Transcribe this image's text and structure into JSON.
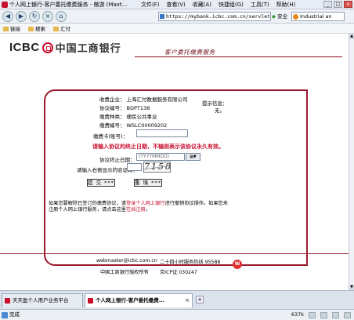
{
  "window": {
    "title": "个人网上银行-客户委托缴费服务 - 傲游 (Maxt...",
    "menu": [
      "文件(F)",
      "查看(V)",
      "收藏(A)",
      "快捷组(G)",
      "工具(T)",
      "帮助(H)"
    ],
    "buttons": [
      "_",
      "□",
      "×"
    ]
  },
  "toolbar": {
    "back": "◀",
    "forward": "▶",
    "refresh": "↻",
    "stop": "×",
    "home": "⌂",
    "address": "https://mybank.icbc.com.cn/servlet/ICBC",
    "security": "安全",
    "search_engine": "Industrial an"
  },
  "favbar": {
    "items": [
      "链接",
      "搜索",
      "汇付"
    ]
  },
  "page": {
    "logo_text": "ICBC",
    "logo_cn": "中国工商银行",
    "slogan": "客户委托缴费服务",
    "form": {
      "company_label": "收费企业：",
      "company_value": "上海汇付数据服务有限公司",
      "protocol_label": "协议编号：",
      "protocol_value": "BDPT138",
      "type_label": "缴费种类：",
      "type_value": "便民公共事业",
      "code_label": "缴费编号：",
      "code_value": "WSLC00009202",
      "card_label": "缴费卡(账号)：",
      "card_value": "",
      "warning": "请输入协议的终止日期，不输则表示该协议永久有效。",
      "end_date_label": "协议终止日期：",
      "end_date_placeholder": "(YYYYMMDD)",
      "captcha_label": "请输入右侧显示的验证码：",
      "captcha_value": "",
      "captcha_text": "7158",
      "submit": "提 交 ***",
      "reset": "重 填 ***",
      "prompt_label": "提示信息：",
      "prompt_value": "无。"
    },
    "note_part1": "如果您要解除已签订的缴费协议，请",
    "note_link1": "登录个人网上银行",
    "note_part2": "进行撤销协议操作。如果您未注册个人网上银行服务，请点击这里",
    "note_link2": "在线注册",
    "note_part3": "。",
    "footer": {
      "email": "webmaster@icbc.com.cn",
      "hotline": "二十四小时服务热线 95588",
      "copyright": "中国工商银行版权所有",
      "icp": "京ICP证 030247"
    }
  },
  "tabs": [
    {
      "label": "天天盈个人用户业务平台"
    },
    {
      "label": "个人网上银行-客户委托缴费..."
    }
  ],
  "status": {
    "text": "完成",
    "size": "637k"
  }
}
